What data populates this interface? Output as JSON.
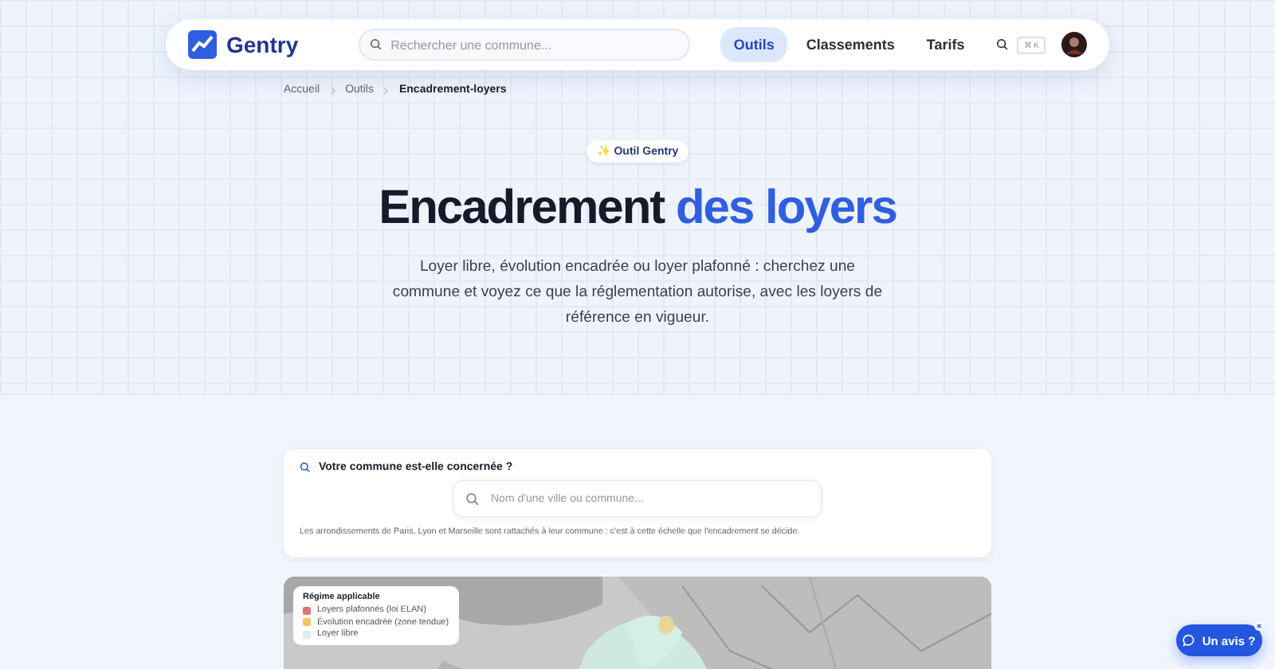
{
  "header": {
    "brand": "Gentry",
    "search": {
      "placeholder": "Rechercher une commune..."
    },
    "nav": [
      {
        "label": "Outils",
        "selected": true
      },
      {
        "label": "Classements",
        "selected": false
      },
      {
        "label": "Tarifs",
        "selected": false
      }
    ],
    "shortcut": "⌘ K"
  },
  "breadcrumb": [
    {
      "label": "Accueil",
      "current": false
    },
    {
      "label": "Outils",
      "current": false
    },
    {
      "label": "Encadrement-loyers",
      "current": true
    }
  ],
  "hero": {
    "badge": "✨ Outil Gentry",
    "title_dark": "Encadrement",
    "title_accent": "des loyers",
    "intro": "Loyer libre, évolution encadrée ou loyer plafonné : cherchez une commune et voyez ce que la réglementation autorise, avec les loyers de référence en vigueur."
  },
  "lookup": {
    "heading": "Votre commune est-elle concernée ?",
    "search": {
      "placeholder": "Nom d'une ville ou commune..."
    },
    "note": "Les arrondissements de Paris, Lyon et Marseille sont rattachés à leur commune : c'est à cette échelle que l'encadrement se décide."
  },
  "map": {
    "kind": "picture",
    "legend": {
      "title": "Régime applicable",
      "items": [
        {
          "label": "Loyers plafonnés (loi ELAN)",
          "color": "#e0707a"
        },
        {
          "label": "Évolution encadrée (zone tendue)",
          "color": "#f0c85a"
        },
        {
          "label": "Loyer libre",
          "color": "#d8f0e8"
        }
      ]
    }
  },
  "feedback": {
    "label": "Un avis ?"
  }
}
